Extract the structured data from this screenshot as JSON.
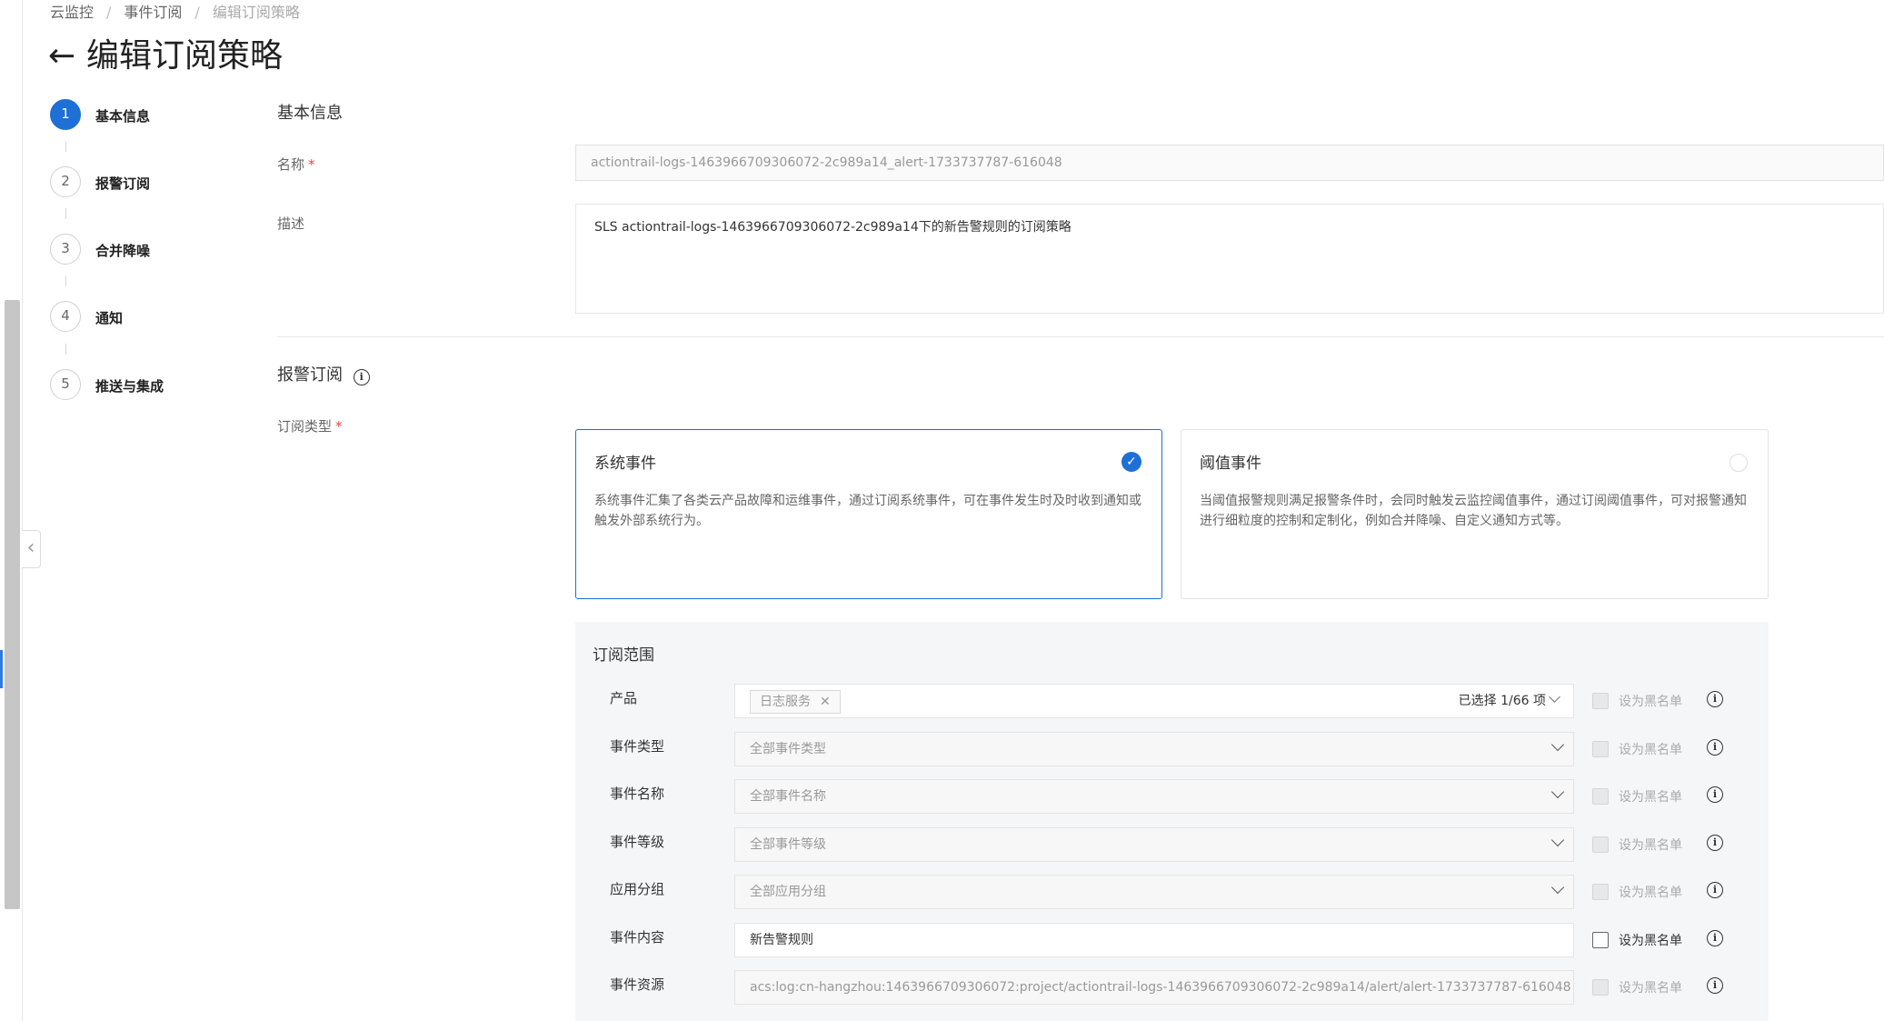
{
  "breadcrumb": [
    "云监控",
    "事件订阅",
    "编辑订阅策略"
  ],
  "page_title": "编辑订阅策略",
  "steps": [
    {
      "num": "1",
      "label": "基本信息",
      "active": true
    },
    {
      "num": "2",
      "label": "报警订阅",
      "active": false
    },
    {
      "num": "3",
      "label": "合并降噪",
      "active": false
    },
    {
      "num": "4",
      "label": "通知",
      "active": false
    },
    {
      "num": "5",
      "label": "推送与集成",
      "active": false
    }
  ],
  "basic": {
    "section_title": "基本信息",
    "name_label": "名称",
    "name_value": "actiontrail-logs-1463966709306072-2c989a14_alert-1733737787-616048",
    "desc_label": "描述",
    "desc_value": "SLS actiontrail-logs-1463966709306072-2c989a14下的新告警规则的订阅策略"
  },
  "alert": {
    "section_title": "报警订阅",
    "type_label": "订阅类型",
    "cards": [
      {
        "title": "系统事件",
        "desc": "系统事件汇集了各类云产品故障和运维事件，通过订阅系统事件，可在事件发生时及时收到通知或触发外部系统行为。",
        "selected": true
      },
      {
        "title": "阈值事件",
        "desc": "当阈值报警规则满足报警条件时，会同时触发云监控阈值事件，通过订阅阈值事件，可对报警通知进行细粒度的控制和定制化，例如合并降噪、自定义通知方式等。",
        "selected": false
      }
    ]
  },
  "scope": {
    "title": "订阅范围",
    "blacklist_label": "设为黑名单",
    "rows": [
      {
        "label": "产品",
        "tag": "日志服务",
        "count": "已选择 1/66 项",
        "blacklist_enabled": false
      },
      {
        "label": "事件类型",
        "value": "全部事件类型",
        "blacklist_enabled": false
      },
      {
        "label": "事件名称",
        "value": "全部事件名称",
        "blacklist_enabled": false
      },
      {
        "label": "事件等级",
        "value": "全部事件等级",
        "blacklist_enabled": false
      },
      {
        "label": "应用分组",
        "value": "全部应用分组",
        "blacklist_enabled": false
      },
      {
        "label": "事件内容",
        "value": "新告警规则",
        "blacklist_enabled": true
      },
      {
        "label": "事件资源",
        "value": "acs:log:cn-hangzhou:1463966709306072:project/actiontrail-logs-1463966709306072-2c989a14/alert/alert-1733737787-616048",
        "blacklist_enabled": false
      }
    ]
  },
  "colors": {
    "accent": "#1e6fd6",
    "required": "#e54545"
  },
  "icons": {
    "back": "arrow-left-icon",
    "info": "info-icon",
    "check": "check-circle-icon",
    "chevron": "chevron-down-icon",
    "collapse": "chevron-left-icon",
    "tag_close": "close-icon"
  }
}
